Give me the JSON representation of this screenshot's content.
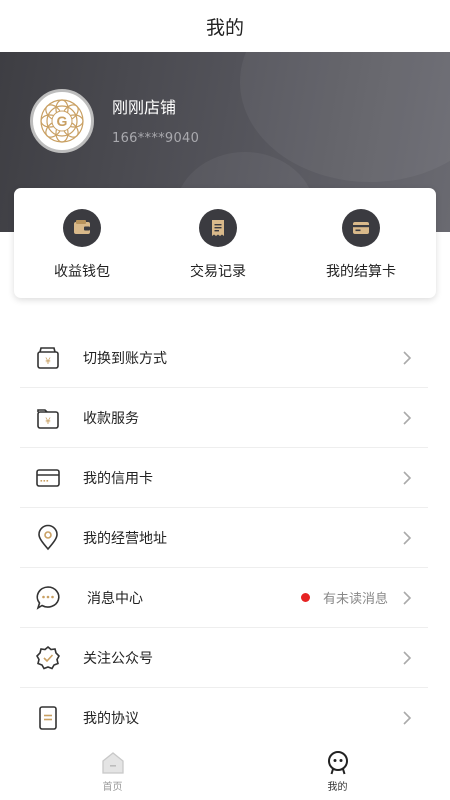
{
  "header": {
    "title": "我的"
  },
  "profile": {
    "shop_name": "刚刚店铺",
    "phone": "166****9040",
    "avatar_letter": "G"
  },
  "quick_actions": [
    {
      "label": "收益钱包",
      "icon": "wallet-icon"
    },
    {
      "label": "交易记录",
      "icon": "receipt-icon"
    },
    {
      "label": "我的结算卡",
      "icon": "card-icon"
    }
  ],
  "menu": [
    {
      "label": "切换到账方式",
      "icon": "yen-wallet-icon"
    },
    {
      "label": "收款服务",
      "icon": "yen-folder-icon"
    },
    {
      "label": "我的信用卡",
      "icon": "credit-card-icon"
    },
    {
      "label": "我的经营地址",
      "icon": "location-icon"
    },
    {
      "label": "消息中心",
      "icon": "chat-icon",
      "badge": "有未读消息"
    },
    {
      "label": "关注公众号",
      "icon": "verified-badge-icon"
    },
    {
      "label": "我的协议",
      "icon": "document-icon"
    }
  ],
  "tabbar": {
    "home": "首页",
    "mine": "我的"
  },
  "colors": {
    "accent_gold": "#c9a063",
    "dark_icon_bg": "#3b3b40",
    "unread_dot": "#e62323"
  }
}
